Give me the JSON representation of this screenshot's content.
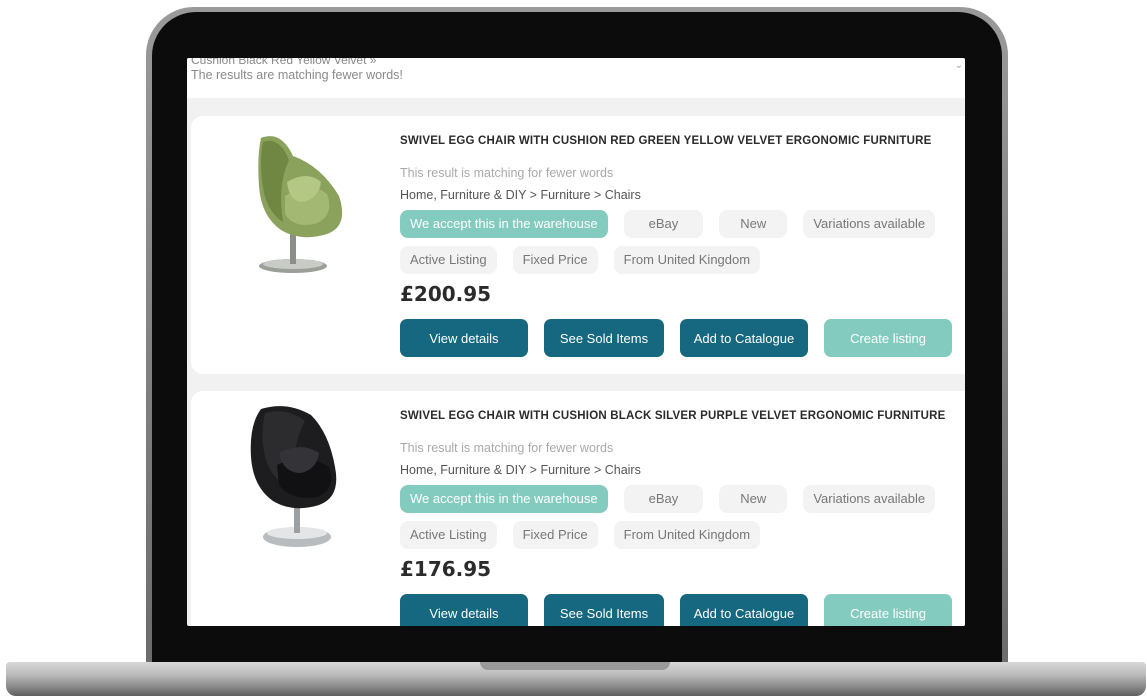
{
  "search_header": {
    "query_cut": "Cushion Black Red Yellow Velvet »",
    "note": "The results are matching fewer words!"
  },
  "colors": {
    "accent_teal": "#84cbbf",
    "primary_button": "#15687f"
  },
  "results": [
    {
      "title": "SWIVEL EGG CHAIR WITH CUSHION RED GREEN YELLOW VELVET ERGONOMIC FURNITURE",
      "match_note": "This result is matching for fewer words",
      "category": "Home, Furniture & DIY > Furniture > Chairs",
      "tags": [
        "We accept this in the warehouse",
        "eBay",
        "New",
        "Variations available",
        "Active Listing",
        "Fixed Price",
        "From United Kingdom"
      ],
      "price": "£200.95",
      "image_icon": "green-egg-chair-image",
      "buttons": {
        "view_details": "View details",
        "see_sold": "See Sold Items",
        "add_catalogue": "Add to Catalogue",
        "create_listing": "Create listing"
      }
    },
    {
      "title": "SWIVEL EGG CHAIR WITH CUSHION BLACK SILVER PURPLE VELVET ERGONOMIC FURNITURE",
      "match_note": "This result is matching for fewer words",
      "category": "Home, Furniture & DIY > Furniture > Chairs",
      "tags": [
        "We accept this in the warehouse",
        "eBay",
        "New",
        "Variations available",
        "Active Listing",
        "Fixed Price",
        "From United Kingdom"
      ],
      "price": "£176.95",
      "image_icon": "black-egg-chair-image",
      "buttons": {
        "view_details": "View details",
        "see_sold": "See Sold Items",
        "add_catalogue": "Add to Catalogue",
        "create_listing": "Create listing"
      }
    }
  ]
}
